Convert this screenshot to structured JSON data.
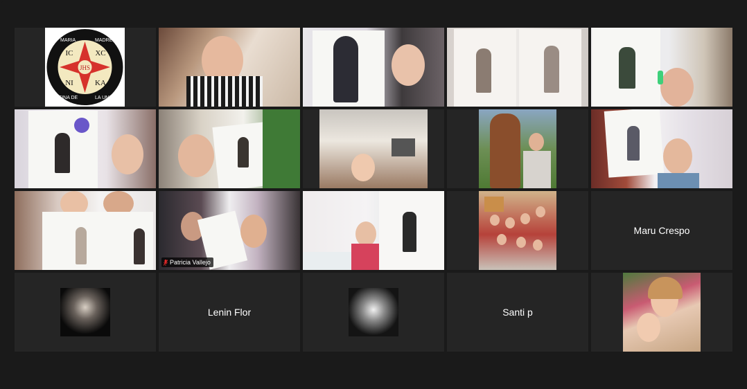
{
  "meeting": {
    "participants": [
      {
        "id": "p1",
        "name": "",
        "type": "logo",
        "logo_text": {
          "top_left": "MARIA",
          "top_right": "MADRE",
          "bottom_left": "Y REINA DE",
          "bottom_right": "LA UNIDAD",
          "quadrants": [
            "IC",
            "XC",
            "NI",
            "KA"
          ],
          "center": "JHS"
        }
      },
      {
        "id": "p2",
        "name": "",
        "type": "video"
      },
      {
        "id": "p3",
        "name": "",
        "type": "video"
      },
      {
        "id": "p4",
        "name": "",
        "type": "video"
      },
      {
        "id": "p5",
        "name": "",
        "type": "video"
      },
      {
        "id": "p6",
        "name": "",
        "type": "video"
      },
      {
        "id": "p7",
        "name": "",
        "type": "video"
      },
      {
        "id": "p8",
        "name": "",
        "type": "video"
      },
      {
        "id": "p9",
        "name": "",
        "type": "video"
      },
      {
        "id": "p10",
        "name": "",
        "type": "video"
      },
      {
        "id": "p11",
        "name": "",
        "type": "video"
      },
      {
        "id": "p12",
        "name": "Patricia Vallejo",
        "type": "video",
        "active_speaker": true,
        "muted": true
      },
      {
        "id": "p13",
        "name": "",
        "type": "video"
      },
      {
        "id": "p14",
        "name": "",
        "type": "video"
      },
      {
        "id": "p15",
        "name": "Maru Crespo",
        "type": "name_only"
      },
      {
        "id": "p16",
        "name": "",
        "type": "avatar"
      },
      {
        "id": "p17",
        "name": "Lenin Flor",
        "type": "name_only"
      },
      {
        "id": "p18",
        "name": "",
        "type": "avatar"
      },
      {
        "id": "p19",
        "name": "Santi p",
        "type": "name_only"
      },
      {
        "id": "p20",
        "name": "",
        "type": "video"
      }
    ],
    "colors": {
      "background": "#1a1a1a",
      "tile": "#252525",
      "active_border": "#c6d77b",
      "mute_icon": "#e02828"
    }
  }
}
